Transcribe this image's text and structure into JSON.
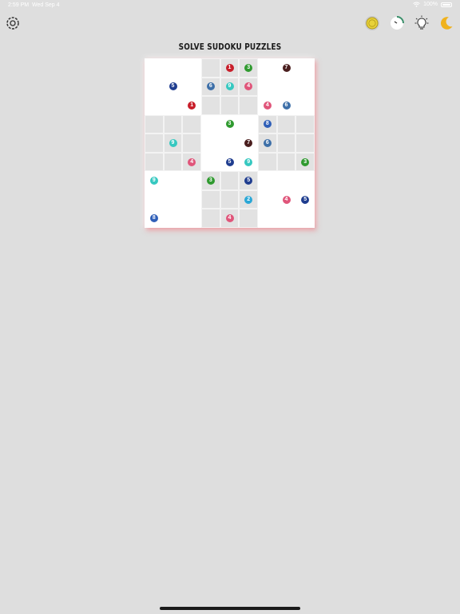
{
  "status_bar": {
    "time": "2:59 PM",
    "date": "Wed Sep 4",
    "battery": "100%"
  },
  "title": "SOLVE SUDOKU PUZZLES",
  "toolbar": {
    "left_icon": "settings-gear-icon",
    "right_icons": [
      "coin-icon",
      "timer-icon",
      "hint-lightbulb-icon",
      "dark-mode-moon-icon"
    ]
  },
  "colors": {
    "1": "#c81e2a",
    "2": "#2aa7d6",
    "3": "#2f9a2f",
    "4": "#e0557a",
    "5": "#1f3d8f",
    "6": "#3d6fa8",
    "7": "#4a1e1e",
    "8": "#2f5fb8",
    "9": "#35c8c0"
  },
  "board": [
    [
      "",
      "",
      "",
      "",
      "1",
      "3",
      "",
      "7",
      ""
    ],
    [
      "",
      "5",
      "",
      "6",
      "9",
      "4",
      "",
      "",
      ""
    ],
    [
      "",
      "",
      "1",
      "",
      "",
      "",
      "4",
      "6",
      ""
    ],
    [
      "",
      "",
      "",
      "",
      "3",
      "",
      "8",
      "",
      ""
    ],
    [
      "",
      "9",
      "",
      "",
      "",
      "7",
      "6",
      "",
      ""
    ],
    [
      "",
      "",
      "4",
      "",
      "5",
      "9",
      "",
      "",
      "3"
    ],
    [
      "9",
      "",
      "",
      "3",
      "",
      "5",
      "",
      "",
      ""
    ],
    [
      "",
      "",
      "",
      "",
      "",
      "2",
      "",
      "4",
      "5"
    ],
    [
      "8",
      "",
      "",
      "",
      "4",
      "",
      "",
      "",
      ""
    ]
  ]
}
